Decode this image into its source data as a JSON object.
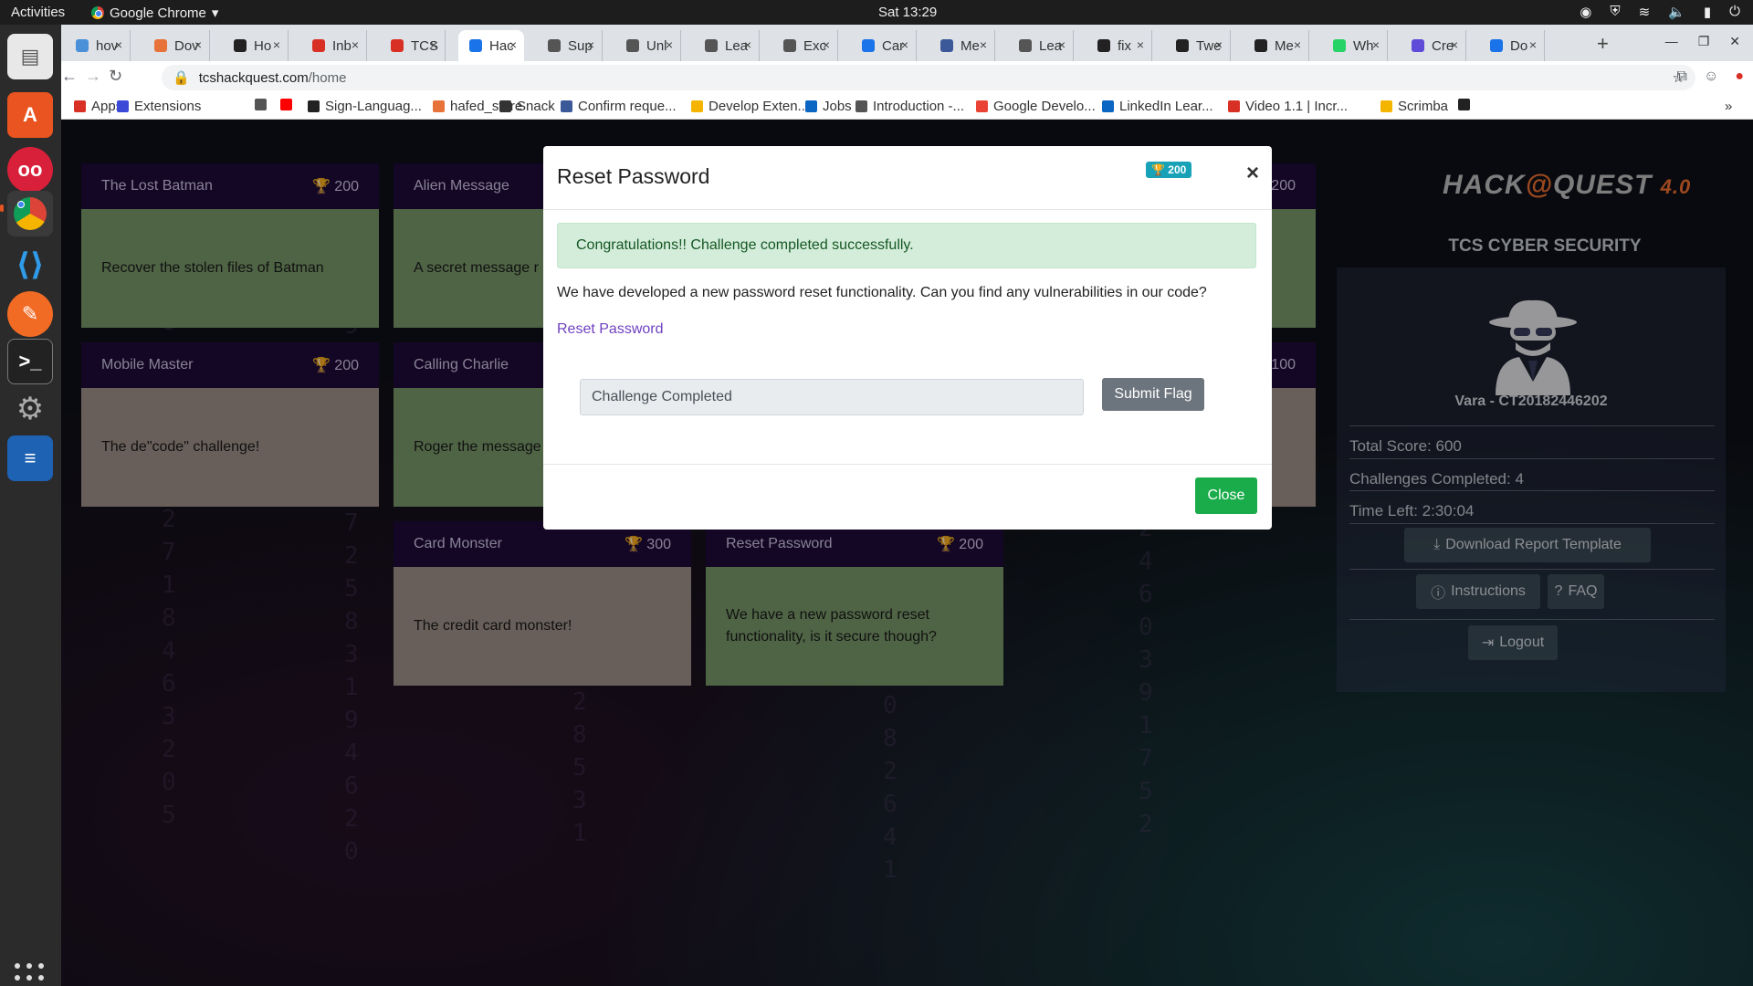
{
  "topbar": {
    "activities": "Activities",
    "app_name": "Google Chrome",
    "clock": "Sat 13:29"
  },
  "tabs": [
    {
      "label": "hov",
      "color": "#4a90d9"
    },
    {
      "label": "Dov",
      "color": "#e8733a"
    },
    {
      "label": "Ho",
      "color": "#222222"
    },
    {
      "label": "Inb",
      "color": "#d93025"
    },
    {
      "label": "TCS",
      "color": "#d93025"
    },
    {
      "label": "Hac",
      "color": "#1a73e8",
      "active": true
    },
    {
      "label": "Sup",
      "color": "#555555"
    },
    {
      "label": "Unl",
      "color": "#555555"
    },
    {
      "label": "Lea",
      "color": "#555555"
    },
    {
      "label": "Exc",
      "color": "#555555"
    },
    {
      "label": "Car",
      "color": "#1a73e8"
    },
    {
      "label": "Me",
      "color": "#3b5998"
    },
    {
      "label": "Lea",
      "color": "#555555"
    },
    {
      "label": "fix",
      "color": "#222222"
    },
    {
      "label": "Twe",
      "color": "#222222"
    },
    {
      "label": "Me",
      "color": "#222222"
    },
    {
      "label": "Wh",
      "color": "#25d366"
    },
    {
      "label": "Cre",
      "color": "#5f4bd8"
    },
    {
      "label": "Do",
      "color": "#1a73e8"
    }
  ],
  "address": {
    "host": "tcshackquest.com",
    "path": "/home"
  },
  "bookmarks": [
    {
      "label": "Apps",
      "color": "#d93025"
    },
    {
      "label": "Extensions",
      "color": "#3c4ad8"
    },
    {
      "label": "",
      "color": "#555555"
    },
    {
      "label": "",
      "color": "#ff0000"
    },
    {
      "label": "Sign-Languag...",
      "color": "#222222"
    },
    {
      "label": "hafed_store",
      "color": "#e8733a"
    },
    {
      "label": "Snack",
      "color": "#333333"
    },
    {
      "label": "Confirm reque...",
      "color": "#3b5998"
    },
    {
      "label": "Develop Exten...",
      "color": "#f4b400"
    },
    {
      "label": "Jobs",
      "color": "#0a66c2"
    },
    {
      "label": "Introduction -...",
      "color": "#555555"
    },
    {
      "label": "Google Develo...",
      "color": "#ea4335"
    },
    {
      "label": "LinkedIn Lear...",
      "color": "#0a66c2"
    },
    {
      "label": "Video 1.1 | Incr...",
      "color": "#d93025"
    },
    {
      "label": "Scrimba",
      "color": "#f4b400"
    },
    {
      "label": "",
      "color": "#222222"
    }
  ],
  "cards": [
    {
      "title": "The Lost Batman",
      "points": "200",
      "body": "Recover the stolen files of Batman",
      "status": "green"
    },
    {
      "title": "Alien Message",
      "points": "",
      "body": "A secret message r space",
      "status": "green"
    },
    {
      "title": "Mobile Master",
      "points": "200",
      "body": "The de\"code\" challenge!",
      "status": "tan"
    },
    {
      "title": "Calling Charlie",
      "points": "",
      "body": "Roger the message",
      "status": "green"
    },
    {
      "title": "Card Monster",
      "points": "300",
      "body": "The credit card monster!",
      "status": "tan"
    },
    {
      "title": "Reset Password",
      "points": "200",
      "body": "We have a new password reset functionality, is it secure though?",
      "status": "green"
    }
  ],
  "hidden_card_points": [
    "200",
    "100"
  ],
  "side": {
    "logo": "HACK",
    "logo2": "QUEST",
    "logo_version": "4.0",
    "org": "TCS CYBER SECURITY",
    "user": "Vara - CT20182446202",
    "total_score": "Total Score: 600",
    "challenges_completed": "Challenges Completed: 4",
    "time_left": "Time Left: 2:30:04",
    "download_btn": "Download Report Template",
    "instructions_btn": "Instructions",
    "faq_btn": "FAQ",
    "logout_btn": "Logout"
  },
  "modal": {
    "title": "Reset Password",
    "badge": "200",
    "alert": "Congratulations!! Challenge completed successfully.",
    "description": "We have developed a new password reset functionality. Can you find any vulnerabilities in our code?",
    "link": "Reset Password",
    "flag_value": "Challenge Completed",
    "submit": "Submit Flag",
    "close": "Close"
  },
  "colors": {
    "accent_green": "#1aac4a",
    "card_green": "#7a9a6a",
    "card_tan": "#a0928a",
    "card_header": "#1f0c3a"
  }
}
